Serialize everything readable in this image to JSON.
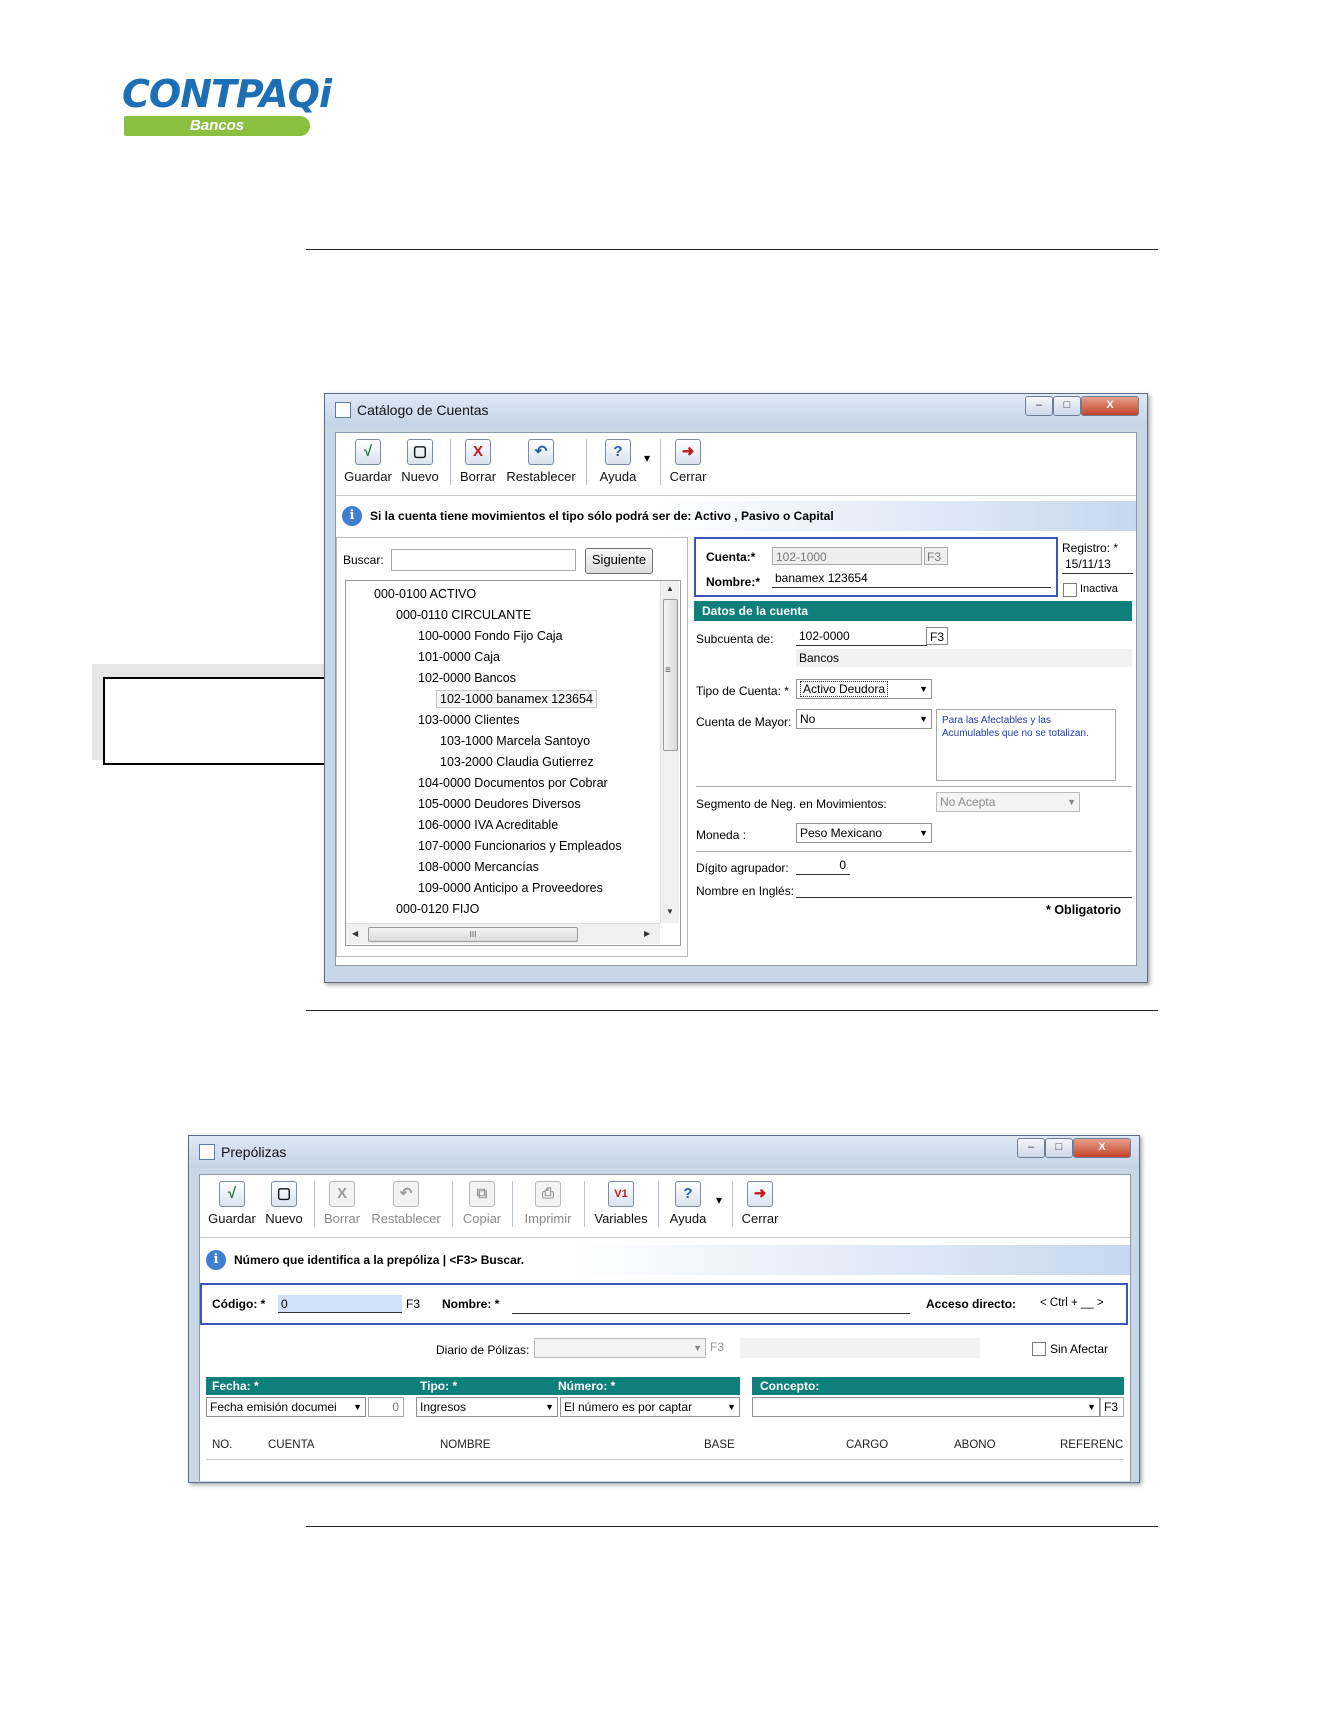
{
  "logo": {
    "brand": "CONTPAQ",
    "brand_i": "i",
    "product": "Bancos"
  },
  "win1": {
    "title": "Catálogo de Cuentas",
    "controls": {
      "min": "–",
      "max": "□",
      "close": "X"
    },
    "toolbar": [
      {
        "label": "Guardar",
        "icon": "checkmark-icon",
        "glyph": "√"
      },
      {
        "label": "Nuevo",
        "icon": "new-document-icon",
        "glyph": "▢"
      },
      {
        "label": "Borrar",
        "icon": "delete-x-icon",
        "glyph": "X"
      },
      {
        "label": "Restablecer",
        "icon": "undo-icon",
        "glyph": "↶"
      },
      {
        "label": "Ayuda",
        "icon": "help-icon",
        "glyph": "?"
      },
      {
        "label": "Cerrar",
        "icon": "exit-door-icon",
        "glyph": "➜"
      }
    ],
    "dropdown_arrow": "▾",
    "info": "Si la cuenta tiene movimientos el tipo sólo podrá ser de: Activo , Pasivo o Capital",
    "info_icon": "i",
    "search_label": "Buscar:",
    "search_value": "",
    "search_button": "Siguiente",
    "tree": [
      "000-0100 ACTIVO",
      "000-0110 CIRCULANTE",
      "100-0000 Fondo Fijo Caja",
      "101-0000 Caja",
      "102-0000 Bancos",
      "102-1000 banamex 123654",
      "103-0000 Clientes",
      "103-1000 Marcela Santoyo",
      "103-2000 Claudia Gutierrez",
      "104-0000 Documentos por Cobrar",
      "105-0000 Deudores Diversos",
      "106-0000 IVA Acreditable",
      "107-0000 Funcionarios y Empleados",
      "108-0000 Mercancías",
      "109-0000 Anticipo a Proveedores",
      "000-0120 FIJO"
    ],
    "scroll": {
      "up": "▲",
      "down": "▼",
      "left": "◀",
      "right": "▶",
      "grip": "III",
      "mark": "≡"
    },
    "cuenta_label": "Cuenta:*",
    "cuenta_value": "102-1000",
    "f3": "F3",
    "nombre_label": "Nombre:*",
    "nombre_value": "banamex 123654",
    "registro_label": "Registro: *",
    "registro_value": "15/11/13",
    "inactiva_label": "Inactiva",
    "section_title": "Datos de la cuenta",
    "subcuenta_label": "Subcuenta de:",
    "subcuenta_value": "102-0000",
    "subcuenta_name": "Bancos",
    "tipo_label": "Tipo de Cuenta: *",
    "tipo_value": "Activo Deudora",
    "mayor_label": "Cuenta de Mayor:",
    "mayor_value": "No",
    "mayor_note": "Para las Afectables y las Acumulables que no se totalizan.",
    "segmento_label": "Segmento de Neg. en Movimientos:",
    "segmento_value": "No Acepta",
    "moneda_label": "Moneda :",
    "moneda_value": "Peso Mexicano",
    "digito_label": "Dígito agrupador:",
    "digito_value": "0",
    "ingles_label": "Nombre en Inglés:",
    "ingles_value": "",
    "obligatorio": "* Obligatorio"
  },
  "win2": {
    "title": "Prepólizas",
    "controls": {
      "min": "–",
      "max": "□",
      "close": "X"
    },
    "toolbar": [
      {
        "label": "Guardar",
        "icon": "checkmark-icon",
        "glyph": "√",
        "enabled": true
      },
      {
        "label": "Nuevo",
        "icon": "new-document-icon",
        "glyph": "▢",
        "enabled": true
      },
      {
        "label": "Borrar",
        "icon": "delete-x-icon",
        "glyph": "X",
        "enabled": false
      },
      {
        "label": "Restablecer",
        "icon": "undo-icon",
        "glyph": "↶",
        "enabled": false
      },
      {
        "label": "Copiar",
        "icon": "copy-icon",
        "glyph": "⧉",
        "enabled": false
      },
      {
        "label": "Imprimir",
        "icon": "printer-icon",
        "glyph": "⎙",
        "enabled": false
      },
      {
        "label": "Variables",
        "icon": "variables-icon",
        "glyph": "V1",
        "enabled": true
      },
      {
        "label": "Ayuda",
        "icon": "help-icon",
        "glyph": "?",
        "enabled": true
      },
      {
        "label": "Cerrar",
        "icon": "exit-door-icon",
        "glyph": "➜",
        "enabled": true
      }
    ],
    "dropdown_arrow": "▾",
    "info": "Número que identifica a la prepóliza | <F3> Buscar.",
    "info_icon": "i",
    "codigo_label": "Código: *",
    "codigo_value": "0",
    "f3": "F3",
    "nombre_label": "Nombre: *",
    "nombre_value": "",
    "acceso_label": "Acceso directo:",
    "acceso_value": "< Ctrl + __ >",
    "diario_label": "Diario de Pólizas:",
    "diario_value": "",
    "sin_afectar": "Sin Afectar",
    "fecha_label": "Fecha: *",
    "fecha_value": "Fecha emisión documei",
    "fecha_num": "0",
    "tipo_label": "Tipo: *",
    "tipo_value": "Ingresos",
    "numero_label": "Número: *",
    "numero_value": "El número es por captar",
    "concepto_label": "Concepto:",
    "concepto_value": "",
    "columns": [
      "NO.",
      "CUENTA",
      "NOMBRE",
      "BASE",
      "CARGO",
      "ABONO",
      "REFERENC"
    ]
  }
}
